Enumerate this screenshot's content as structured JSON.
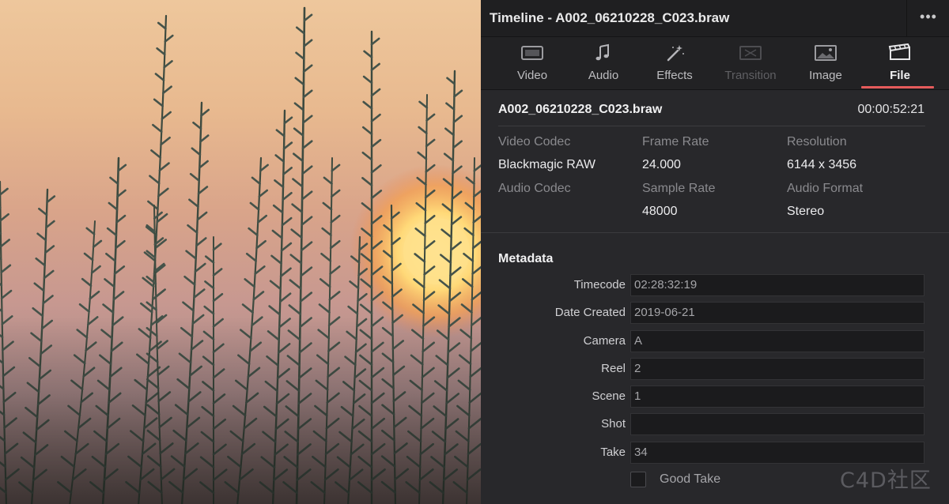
{
  "viewer": {
    "image_description": ""
  },
  "header": {
    "title": "Timeline - A002_06210228_C023.braw",
    "more_glyph": "•••"
  },
  "tabs": [
    {
      "label": "Video",
      "icon": "video-icon",
      "state": "normal"
    },
    {
      "label": "Audio",
      "icon": "music-note-icon",
      "state": "normal"
    },
    {
      "label": "Effects",
      "icon": "magic-wand-icon",
      "state": "normal"
    },
    {
      "label": "Transition",
      "icon": "transition-icon",
      "state": "disabled"
    },
    {
      "label": "Image",
      "icon": "image-icon",
      "state": "normal"
    },
    {
      "label": "File",
      "icon": "file-clapper-icon",
      "state": "active"
    }
  ],
  "clip": {
    "name": "A002_06210228_C023.braw",
    "duration": "00:00:52:21"
  },
  "info": {
    "video_codec": {
      "label": "Video Codec",
      "value": "Blackmagic RAW"
    },
    "frame_rate": {
      "label": "Frame Rate",
      "value": "24.000"
    },
    "resolution": {
      "label": "Resolution",
      "value": "6144 x 3456"
    },
    "audio_codec": {
      "label": "Audio Codec",
      "value": ""
    },
    "sample_rate": {
      "label": "Sample Rate",
      "value": "48000"
    },
    "audio_format": {
      "label": "Audio Format",
      "value": "Stereo"
    }
  },
  "metadata": {
    "heading": "Metadata",
    "fields": [
      {
        "label": "Timecode",
        "value": "02:28:32:19"
      },
      {
        "label": "Date Created",
        "value": "2019-06-21"
      },
      {
        "label": "Camera",
        "value": "A"
      },
      {
        "label": "Reel",
        "value": "2"
      },
      {
        "label": "Scene",
        "value": "1"
      },
      {
        "label": "Shot",
        "value": ""
      },
      {
        "label": "Take",
        "value": "34"
      }
    ],
    "good_take": {
      "label": "Good Take",
      "checked": false
    }
  },
  "watermark": "C4D社区",
  "colors": {
    "accent": "#e55b5b",
    "panel_bg": "#28282b",
    "field_bg": "#1b1b1d"
  }
}
